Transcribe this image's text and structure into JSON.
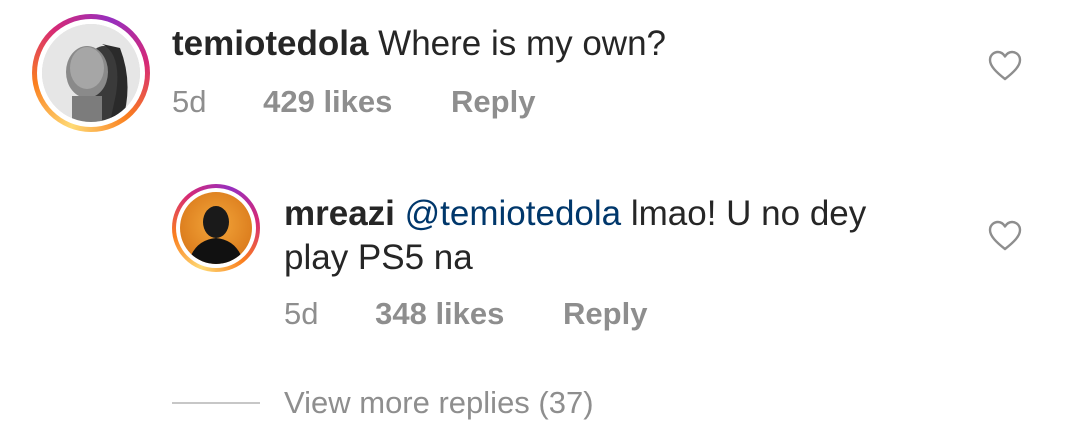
{
  "comments": [
    {
      "username": "temiotedola",
      "text": "Where is my own?",
      "age": "5d",
      "likes": "429 likes",
      "reply_label": "Reply"
    }
  ],
  "replies": [
    {
      "username": "mreazi",
      "mention": "@temiotedola",
      "text_line1": "lmao! U no dey",
      "text_line2": "play PS5 na",
      "age": "5d",
      "likes": "348 likes",
      "reply_label": "Reply"
    }
  ],
  "view_more": "View more replies (37)",
  "colors": {
    "text": "#262626",
    "meta": "#8e8e8e",
    "mention": "#00376b",
    "divider": "#c7c7c7"
  },
  "icons": [
    "heart-icon",
    "avatar-temiotedola",
    "avatar-mreazi"
  ]
}
